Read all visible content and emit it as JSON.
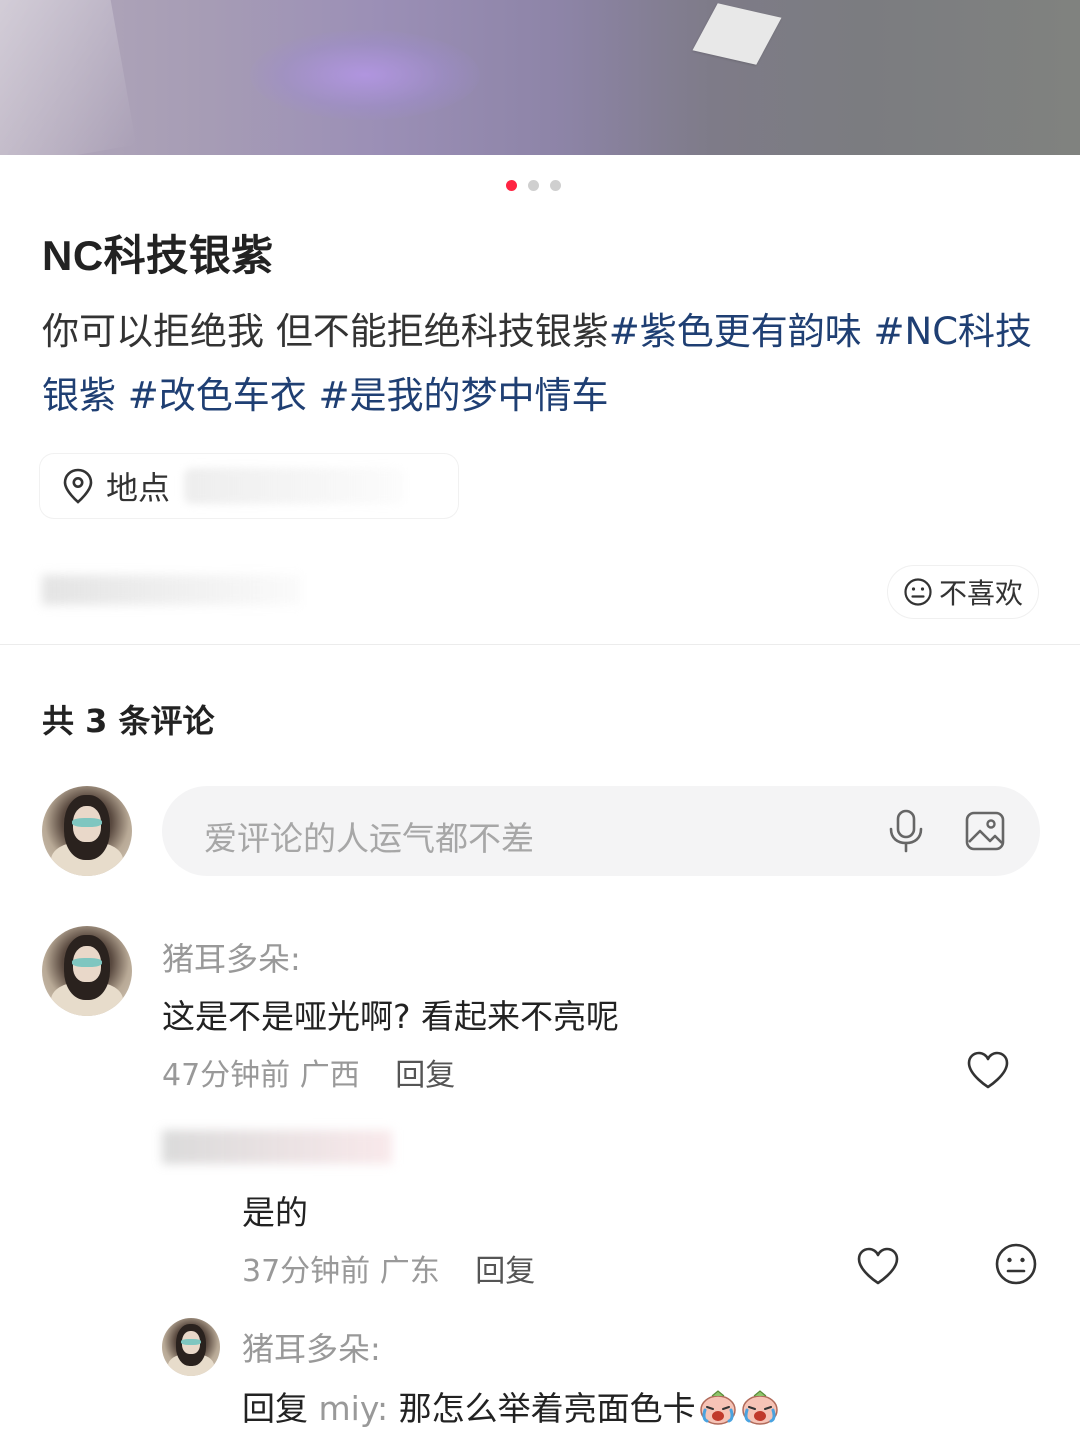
{
  "post": {
    "title": "NC科技银紫",
    "body_plain": "你可以拒绝我 但不能拒绝科技银紫",
    "tags": [
      "#紫色更有韵味",
      "#NC科技银紫",
      "#改色车衣",
      "#是我的梦中情车"
    ],
    "location_label": "地点",
    "dislike_label": "不喜欢",
    "carousel": {
      "total": 3,
      "active": 1
    }
  },
  "comments_section": {
    "count_label": "共 3 条评论",
    "input_placeholder": "爱评论的人运气都不差"
  },
  "comments": [
    {
      "user": "猪耳多朵:",
      "text": "这是不是哑光啊? 看起来不亮呢",
      "meta": "47分钟前 广西",
      "reply_label": "回复"
    },
    {
      "user": "",
      "text": "是的",
      "meta": "37分钟前 广东",
      "reply_label": "回复"
    },
    {
      "user": "猪耳多朵:",
      "reply_prefix": "回复",
      "reply_to": "miy:",
      "text": "那怎么举着亮面色卡"
    }
  ],
  "colors": {
    "accent": "#ff2442",
    "hashtag": "#1f3f73",
    "muted": "#999999"
  },
  "icons": [
    "location-pin-icon",
    "neutral-face-icon",
    "microphone-icon",
    "image-icon",
    "heart-icon",
    "crying-emoji-icon"
  ]
}
